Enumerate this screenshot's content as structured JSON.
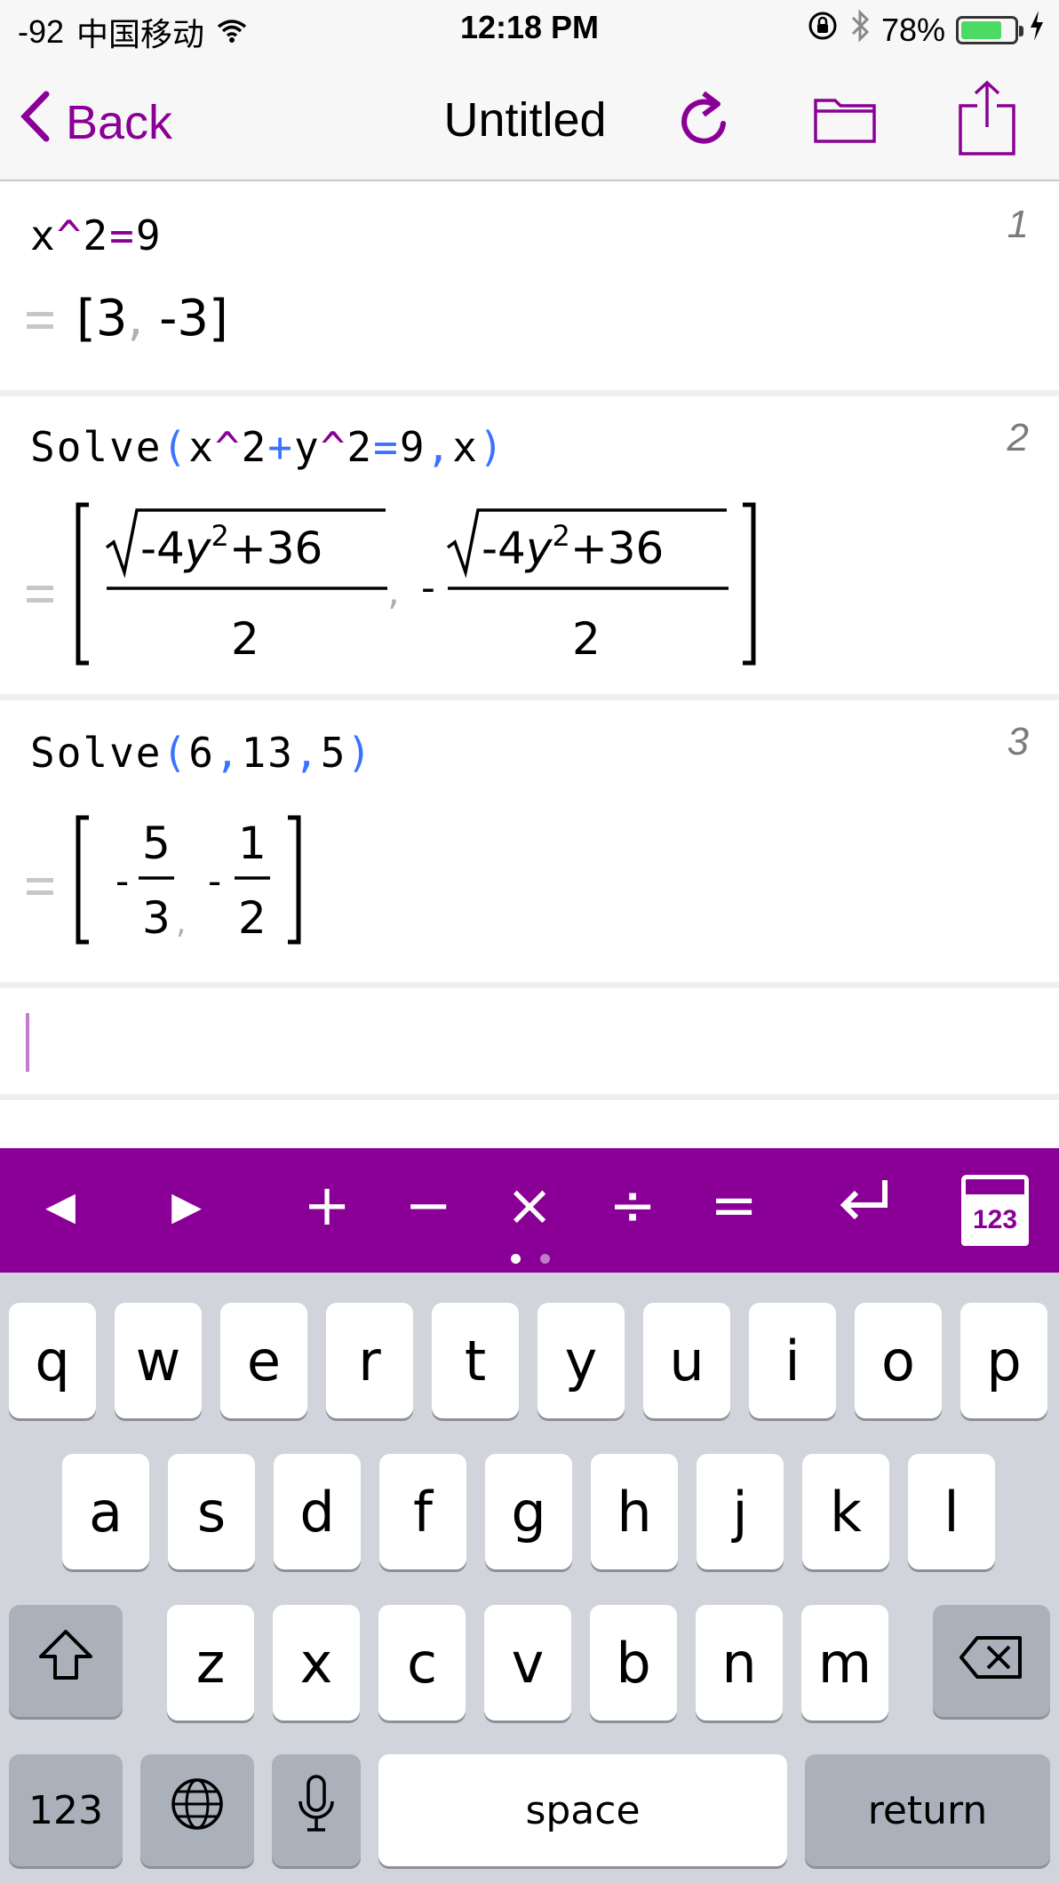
{
  "status_bar": {
    "signal": "-92",
    "carrier": "中国移动",
    "time": "12:18 PM",
    "battery": "78%",
    "battery_level": 0.78,
    "battery_color": "#4cd964"
  },
  "nav": {
    "back_label": "Back",
    "title": "Untitled",
    "accent_color": "#8a0096",
    "icons": [
      "back-chevron-icon",
      "refresh-icon",
      "folder-icon",
      "share-icon"
    ]
  },
  "cells": [
    {
      "number": "1",
      "input": {
        "a": "x",
        "op1": "^",
        "b": "2",
        "op2": "=",
        "c": "9"
      },
      "result": {
        "open": "[",
        "v1": "3",
        "comma": ",",
        "v2": " -3",
        "close": "]"
      }
    },
    {
      "number": "2",
      "input": {
        "fn": "Solve",
        "p1": "(",
        "t1": "x",
        "o1": "^",
        "t2": "2",
        "o2": "+",
        "t3": "y",
        "o3": "^",
        "t4": "2",
        "o4": "=",
        "t5": "9",
        "o5": ",",
        "t6": "x",
        "p2": ")"
      },
      "result": {
        "neg": "-",
        "rad_pre": "-4",
        "rad_var": "y",
        "rad_exp": "2",
        "rad_post": "+36",
        "den": "2",
        "comma": ","
      }
    },
    {
      "number": "3",
      "input": {
        "fn": "Solve",
        "p1": "(",
        "a": "6",
        "c1": ",",
        "b": "13",
        "c2": ",",
        "c": "5",
        "p2": ")"
      },
      "result": {
        "neg": "-",
        "n1": "5",
        "d1": "3",
        "comma": ",",
        "n2": "1",
        "d2": "2"
      }
    }
  ],
  "toolbar": {
    "left": "◀",
    "right": "▶",
    "plus": "+",
    "minus": "−",
    "times": "×",
    "divide": "÷",
    "equals": "=",
    "return": "↵",
    "calc_badge": "123",
    "page_count": 2,
    "current_page": 1
  },
  "keyboard": {
    "row1": [
      "q",
      "w",
      "e",
      "r",
      "t",
      "y",
      "u",
      "i",
      "o",
      "p"
    ],
    "row2": [
      "a",
      "s",
      "d",
      "f",
      "g",
      "h",
      "j",
      "k",
      "l"
    ],
    "row3": [
      "z",
      "x",
      "c",
      "v",
      "b",
      "n",
      "m"
    ],
    "numbers_key": "123",
    "space_key": "space",
    "return_key": "return"
  }
}
